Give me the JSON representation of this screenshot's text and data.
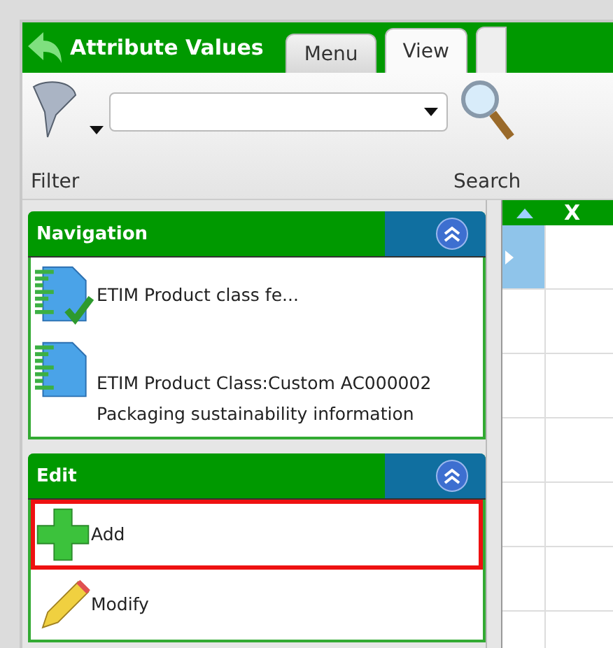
{
  "header": {
    "title": "Attribute Values"
  },
  "tabs": [
    {
      "label": "Menu",
      "selected": false
    },
    {
      "label": "View",
      "selected": true
    }
  ],
  "toolbar": {
    "filter_label": "Filter",
    "search_label": "Search"
  },
  "panels": [
    {
      "title": "Navigation",
      "items": [
        {
          "kind": "checked-doc",
          "label": "ETIM Product class fe...",
          "highlighted": false
        },
        {
          "kind": "doc",
          "label": "ETIM Product Class:Custom AC000002 Packaging sustainability information",
          "highlighted": false
        }
      ]
    },
    {
      "title": "Edit",
      "items": [
        {
          "kind": "add",
          "label": "Add",
          "highlighted": true
        },
        {
          "kind": "pencil",
          "label": "Modify",
          "highlighted": false
        }
      ]
    }
  ],
  "grid": {
    "column_1": "X"
  }
}
